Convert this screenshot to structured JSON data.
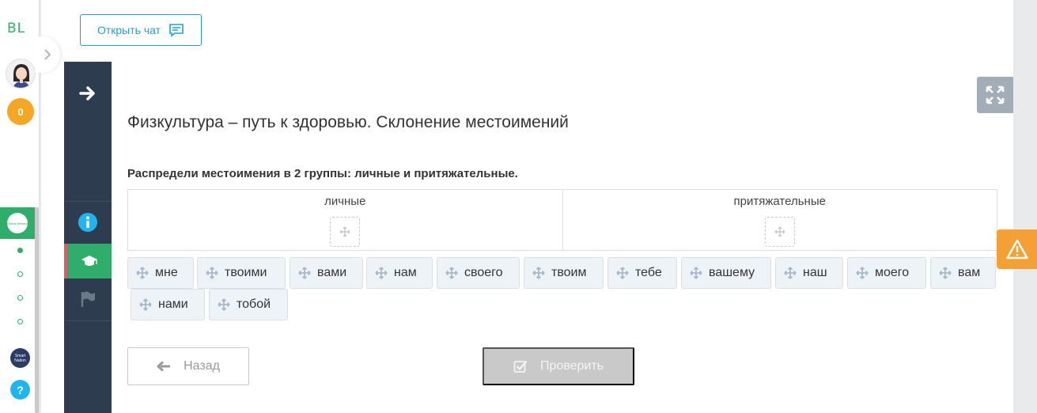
{
  "sidebar": {
    "logo_text": "BL",
    "points": "0",
    "online_badge_text": "Online Mektep",
    "smart_badge_text": "Smart Nation",
    "help_label": "?"
  },
  "header": {
    "chat_button_label": "Открыть чат"
  },
  "lesson": {
    "title": "Физкультура – путь к здоровью. Склонение местоимений",
    "task": "Распредели местоимения в 2 группы: личные и притяжательные."
  },
  "groups": [
    {
      "label": "личные"
    },
    {
      "label": "притяжательные"
    }
  ],
  "chips": [
    {
      "label": "мне"
    },
    {
      "label": "твоими"
    },
    {
      "label": "вами"
    },
    {
      "label": "нам"
    },
    {
      "label": "своего"
    },
    {
      "label": "твоим"
    },
    {
      "label": "тебе"
    },
    {
      "label": "вашему"
    },
    {
      "label": "наш"
    },
    {
      "label": "моего"
    },
    {
      "label": "вам"
    },
    {
      "label": "нами"
    },
    {
      "label": "тобой"
    }
  ],
  "buttons": {
    "back_label": "Назад",
    "check_label": "Проверить"
  },
  "colors": {
    "accent": "#1f9fd4",
    "green": "#2fae6b",
    "dark_nav": "#2d3d4f",
    "warning": "#f5a034"
  }
}
